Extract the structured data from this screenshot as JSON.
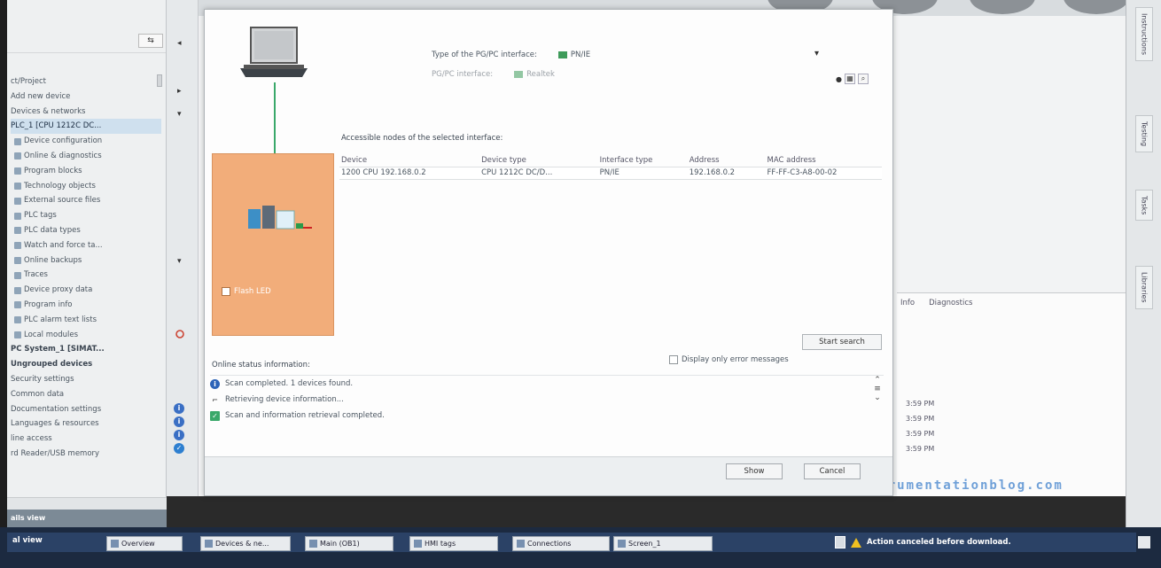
{
  "tree": {
    "header_line1": "",
    "header_line2": "",
    "items": [
      {
        "label": "ct/Project",
        "style": "plain"
      },
      {
        "label": "Add new device",
        "style": "plain"
      },
      {
        "label": "Devices & networks",
        "style": "plain"
      },
      {
        "label": "PLC_1 [CPU 1212C DC...",
        "style": "sel"
      },
      {
        "label": "Device configuration",
        "style": "sub"
      },
      {
        "label": "Online & diagnostics",
        "style": "sub"
      },
      {
        "label": "Program blocks",
        "style": "sub"
      },
      {
        "label": "Technology objects",
        "style": "sub"
      },
      {
        "label": "External source files",
        "style": "sub"
      },
      {
        "label": "PLC tags",
        "style": "sub"
      },
      {
        "label": "PLC data types",
        "style": "sub"
      },
      {
        "label": "Watch and force ta...",
        "style": "sub"
      },
      {
        "label": "Online backups",
        "style": "sub"
      },
      {
        "label": "Traces",
        "style": "sub"
      },
      {
        "label": "Device proxy data",
        "style": "sub"
      },
      {
        "label": "Program info",
        "style": "sub"
      },
      {
        "label": "PLC alarm text lists",
        "style": "sub"
      },
      {
        "label": "Local modules",
        "style": "sub"
      },
      {
        "label": "PC System_1 [SIMAT...",
        "style": "bold"
      },
      {
        "label": "Ungrouped devices",
        "style": "bold"
      },
      {
        "label": "Security settings",
        "style": "plain"
      },
      {
        "label": "Common data",
        "style": "plain"
      },
      {
        "label": "Documentation settings",
        "style": "plain"
      },
      {
        "label": "Languages & resources",
        "style": "plain"
      },
      {
        "label": "line access",
        "style": "plain"
      },
      {
        "label": "rd Reader/USB memory",
        "style": "plain"
      }
    ],
    "details_label": "ails view"
  },
  "dialog": {
    "pgpc_type_label": "Type of the PG/PC interface:",
    "pgpc_type_value": "PN/IE",
    "pgpc_iface_label": "PG/PC interface:",
    "pgpc_iface_value": "Realtek",
    "nodes_caption": "Accessible nodes of the selected interface:",
    "columns": [
      "Device",
      "Device type",
      "Interface type",
      "Address",
      "MAC address"
    ],
    "rows": [
      [
        "1200 CPU 192.168.0.2",
        "CPU 1212C DC/D...",
        "PN/IE",
        "192.168.0.2",
        "FF-FF-C3-A8-00-02"
      ]
    ],
    "flash_led_label": "Flash LED",
    "start_search_label": "Start search",
    "error_only_label": "Display only error messages",
    "online_status_label": "Online status information:",
    "status_lines": [
      {
        "icon": "info-icon",
        "text": "Scan completed. 1 devices found."
      },
      {
        "icon": "pc-icon",
        "text": "Retrieving device information..."
      },
      {
        "icon": "check-icon",
        "text": "Scan and information retrieval completed."
      }
    ],
    "show_label": "Show",
    "cancel_label": "Cancel"
  },
  "inspector": {
    "tabs": [
      "Info",
      "Diagnostics"
    ],
    "times": [
      "3:59 PM",
      "3:59 PM",
      "3:59 PM",
      "3:59 PM"
    ]
  },
  "cards": [
    "Instructions",
    "Testing",
    "Tasks",
    "Libraries"
  ],
  "taskbar": {
    "portal_label": "al view",
    "buttons": [
      {
        "label": "Overview"
      },
      {
        "label": "Devices & ne..."
      },
      {
        "label": "Main (OB1)"
      },
      {
        "label": "HMI tags"
      },
      {
        "label": "Connections"
      },
      {
        "label": "Screen_1"
      }
    ],
    "status_text": "Action canceled before download."
  },
  "watermark": "instrumentationblog.com",
  "colors": {
    "device_panel": "#f2ad7a",
    "cable": "#3aa86a",
    "accent": "#2d64b8",
    "taskbar": "#1c2a40"
  }
}
